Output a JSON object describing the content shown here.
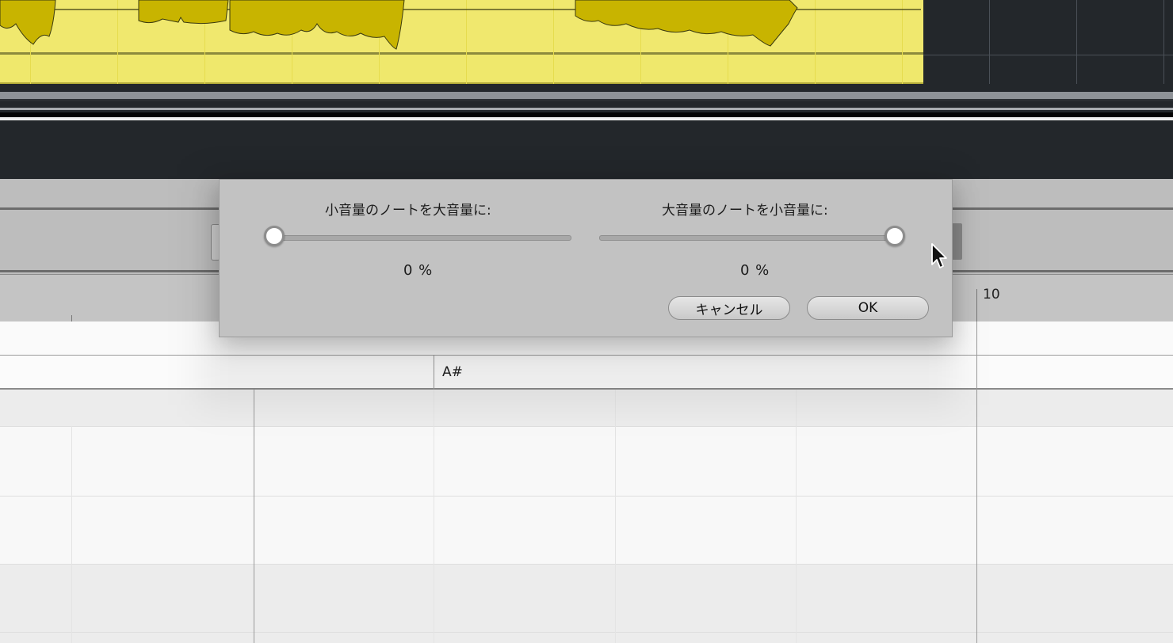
{
  "dialog": {
    "left_label": "小音量のノートを大音量に:",
    "right_label": "大音量のノートを小音量に:",
    "left_value": "0 %",
    "right_value": "0 %",
    "left_slider_fraction": 0.0,
    "right_slider_fraction": 1.0,
    "cancel_label": "キャンセル",
    "ok_label": "OK"
  },
  "ruler": {
    "bar_number": "10"
  },
  "pianoroll": {
    "chord_label": "A#"
  },
  "colors": {
    "region_fill": "#f0e86e",
    "waveform": "#c8b400",
    "arrange_bg": "#23272b",
    "dialog_bg": "#c2c2c2"
  }
}
